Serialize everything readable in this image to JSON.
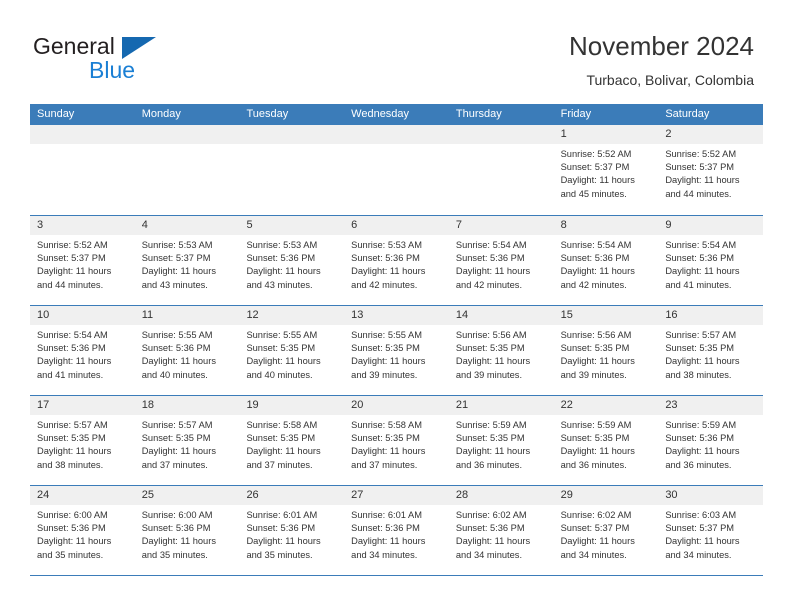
{
  "brand": {
    "name_part1": "General",
    "name_part2": "Blue",
    "accent_color": "#1a7fd4",
    "triangle_color": "#1568b0"
  },
  "header": {
    "title": "November 2024",
    "subtitle": "Turbaco, Bolivar, Colombia"
  },
  "calendar": {
    "header_bg": "#3b7cb9",
    "weekdays": [
      "Sunday",
      "Monday",
      "Tuesday",
      "Wednesday",
      "Thursday",
      "Friday",
      "Saturday"
    ],
    "weeks": [
      [
        {
          "day": "",
          "empty": true,
          "lines": []
        },
        {
          "day": "",
          "empty": true,
          "lines": []
        },
        {
          "day": "",
          "empty": true,
          "lines": []
        },
        {
          "day": "",
          "empty": true,
          "lines": []
        },
        {
          "day": "",
          "empty": true,
          "lines": []
        },
        {
          "day": "1",
          "empty": false,
          "lines": [
            "Sunrise: 5:52 AM",
            "Sunset: 5:37 PM",
            "Daylight: 11 hours",
            "and 45 minutes."
          ]
        },
        {
          "day": "2",
          "empty": false,
          "lines": [
            "Sunrise: 5:52 AM",
            "Sunset: 5:37 PM",
            "Daylight: 11 hours",
            "and 44 minutes."
          ]
        }
      ],
      [
        {
          "day": "3",
          "empty": false,
          "lines": [
            "Sunrise: 5:52 AM",
            "Sunset: 5:37 PM",
            "Daylight: 11 hours",
            "and 44 minutes."
          ]
        },
        {
          "day": "4",
          "empty": false,
          "lines": [
            "Sunrise: 5:53 AM",
            "Sunset: 5:37 PM",
            "Daylight: 11 hours",
            "and 43 minutes."
          ]
        },
        {
          "day": "5",
          "empty": false,
          "lines": [
            "Sunrise: 5:53 AM",
            "Sunset: 5:36 PM",
            "Daylight: 11 hours",
            "and 43 minutes."
          ]
        },
        {
          "day": "6",
          "empty": false,
          "lines": [
            "Sunrise: 5:53 AM",
            "Sunset: 5:36 PM",
            "Daylight: 11 hours",
            "and 42 minutes."
          ]
        },
        {
          "day": "7",
          "empty": false,
          "lines": [
            "Sunrise: 5:54 AM",
            "Sunset: 5:36 PM",
            "Daylight: 11 hours",
            "and 42 minutes."
          ]
        },
        {
          "day": "8",
          "empty": false,
          "lines": [
            "Sunrise: 5:54 AM",
            "Sunset: 5:36 PM",
            "Daylight: 11 hours",
            "and 42 minutes."
          ]
        },
        {
          "day": "9",
          "empty": false,
          "lines": [
            "Sunrise: 5:54 AM",
            "Sunset: 5:36 PM",
            "Daylight: 11 hours",
            "and 41 minutes."
          ]
        }
      ],
      [
        {
          "day": "10",
          "empty": false,
          "lines": [
            "Sunrise: 5:54 AM",
            "Sunset: 5:36 PM",
            "Daylight: 11 hours",
            "and 41 minutes."
          ]
        },
        {
          "day": "11",
          "empty": false,
          "lines": [
            "Sunrise: 5:55 AM",
            "Sunset: 5:36 PM",
            "Daylight: 11 hours",
            "and 40 minutes."
          ]
        },
        {
          "day": "12",
          "empty": false,
          "lines": [
            "Sunrise: 5:55 AM",
            "Sunset: 5:35 PM",
            "Daylight: 11 hours",
            "and 40 minutes."
          ]
        },
        {
          "day": "13",
          "empty": false,
          "lines": [
            "Sunrise: 5:55 AM",
            "Sunset: 5:35 PM",
            "Daylight: 11 hours",
            "and 39 minutes."
          ]
        },
        {
          "day": "14",
          "empty": false,
          "lines": [
            "Sunrise: 5:56 AM",
            "Sunset: 5:35 PM",
            "Daylight: 11 hours",
            "and 39 minutes."
          ]
        },
        {
          "day": "15",
          "empty": false,
          "lines": [
            "Sunrise: 5:56 AM",
            "Sunset: 5:35 PM",
            "Daylight: 11 hours",
            "and 39 minutes."
          ]
        },
        {
          "day": "16",
          "empty": false,
          "lines": [
            "Sunrise: 5:57 AM",
            "Sunset: 5:35 PM",
            "Daylight: 11 hours",
            "and 38 minutes."
          ]
        }
      ],
      [
        {
          "day": "17",
          "empty": false,
          "lines": [
            "Sunrise: 5:57 AM",
            "Sunset: 5:35 PM",
            "Daylight: 11 hours",
            "and 38 minutes."
          ]
        },
        {
          "day": "18",
          "empty": false,
          "lines": [
            "Sunrise: 5:57 AM",
            "Sunset: 5:35 PM",
            "Daylight: 11 hours",
            "and 37 minutes."
          ]
        },
        {
          "day": "19",
          "empty": false,
          "lines": [
            "Sunrise: 5:58 AM",
            "Sunset: 5:35 PM",
            "Daylight: 11 hours",
            "and 37 minutes."
          ]
        },
        {
          "day": "20",
          "empty": false,
          "lines": [
            "Sunrise: 5:58 AM",
            "Sunset: 5:35 PM",
            "Daylight: 11 hours",
            "and 37 minutes."
          ]
        },
        {
          "day": "21",
          "empty": false,
          "lines": [
            "Sunrise: 5:59 AM",
            "Sunset: 5:35 PM",
            "Daylight: 11 hours",
            "and 36 minutes."
          ]
        },
        {
          "day": "22",
          "empty": false,
          "lines": [
            "Sunrise: 5:59 AM",
            "Sunset: 5:35 PM",
            "Daylight: 11 hours",
            "and 36 minutes."
          ]
        },
        {
          "day": "23",
          "empty": false,
          "lines": [
            "Sunrise: 5:59 AM",
            "Sunset: 5:36 PM",
            "Daylight: 11 hours",
            "and 36 minutes."
          ]
        }
      ],
      [
        {
          "day": "24",
          "empty": false,
          "lines": [
            "Sunrise: 6:00 AM",
            "Sunset: 5:36 PM",
            "Daylight: 11 hours",
            "and 35 minutes."
          ]
        },
        {
          "day": "25",
          "empty": false,
          "lines": [
            "Sunrise: 6:00 AM",
            "Sunset: 5:36 PM",
            "Daylight: 11 hours",
            "and 35 minutes."
          ]
        },
        {
          "day": "26",
          "empty": false,
          "lines": [
            "Sunrise: 6:01 AM",
            "Sunset: 5:36 PM",
            "Daylight: 11 hours",
            "and 35 minutes."
          ]
        },
        {
          "day": "27",
          "empty": false,
          "lines": [
            "Sunrise: 6:01 AM",
            "Sunset: 5:36 PM",
            "Daylight: 11 hours",
            "and 34 minutes."
          ]
        },
        {
          "day": "28",
          "empty": false,
          "lines": [
            "Sunrise: 6:02 AM",
            "Sunset: 5:36 PM",
            "Daylight: 11 hours",
            "and 34 minutes."
          ]
        },
        {
          "day": "29",
          "empty": false,
          "lines": [
            "Sunrise: 6:02 AM",
            "Sunset: 5:37 PM",
            "Daylight: 11 hours",
            "and 34 minutes."
          ]
        },
        {
          "day": "30",
          "empty": false,
          "lines": [
            "Sunrise: 6:03 AM",
            "Sunset: 5:37 PM",
            "Daylight: 11 hours",
            "and 34 minutes."
          ]
        }
      ]
    ]
  }
}
